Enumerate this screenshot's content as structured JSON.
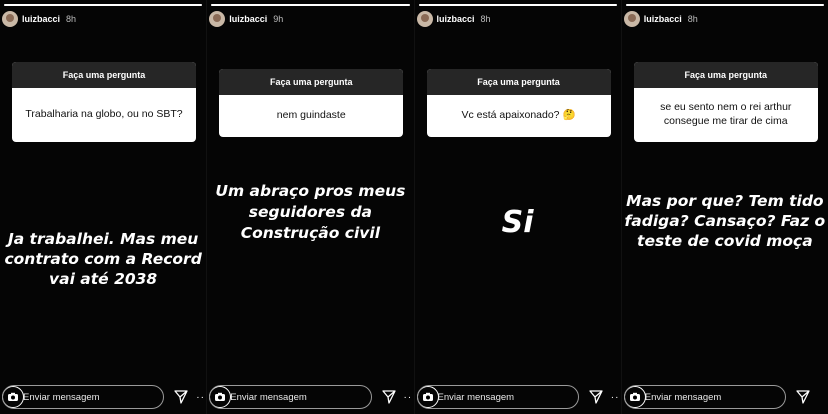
{
  "story": {
    "question_header": "Faça uma pergunta",
    "message_placeholder": "Enviar mensagem",
    "username": "luizbacci"
  },
  "panels": [
    {
      "time": "8h",
      "progress": 1.0,
      "question": "Trabalharia na globo, ou no SBT?",
      "answer": "Ja trabalhei. Mas meu\ncontrato com a Record\nvai até 2038"
    },
    {
      "time": "9h",
      "progress": 1.0,
      "question": "nem guindaste",
      "answer": "Um abraço pros meus\nseguidores da\nConstrução civil"
    },
    {
      "time": "8h",
      "progress": 1.0,
      "question": "Vc está apaixonado? 🤔",
      "answer": "Si"
    },
    {
      "time": "8h",
      "progress": 1.0,
      "question": "se eu sento nem o rei arthur consegue me tirar de cima",
      "answer": "Mas por que? Tem tido\nfadiga? Cansaço? Faz o\nteste de covid moça"
    }
  ],
  "icons": {
    "camera": "camera-icon",
    "send": "send-icon",
    "more": "more-icon"
  }
}
